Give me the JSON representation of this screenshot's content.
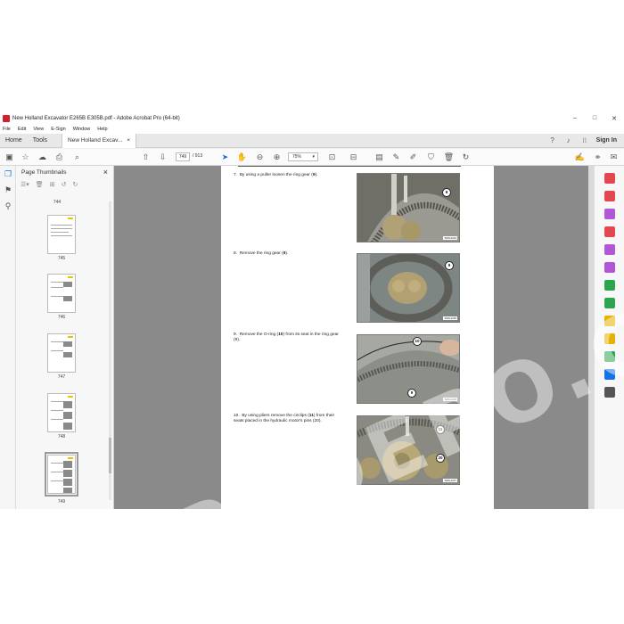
{
  "window": {
    "title": "New Holland Excavator E265B E305B.pdf - Adobe Acrobat Pro (64-bit)",
    "controls": [
      "–",
      "□",
      "✕"
    ]
  },
  "menu": [
    "File",
    "Edit",
    "View",
    "E-Sign",
    "Window",
    "Help"
  ],
  "tabs": {
    "home": "Home",
    "tools": "Tools",
    "document": "New Holland Excav...",
    "document_close": "×",
    "sign_in": "Sign In"
  },
  "toolbar": {
    "current_page": "749",
    "total_pages": "/ 913",
    "zoom": "75%",
    "zoom_caret": "▾"
  },
  "thumbnails": {
    "title": "Page Thumbnails",
    "close": "×",
    "pages": [
      "744",
      "745",
      "746",
      "747",
      "748",
      "749"
    ],
    "selected": "749"
  },
  "document": {
    "steps": [
      {
        "num": "7.",
        "text_before": "By using a puller loosen the ring gear (",
        "bold": "9",
        "text_after": ").",
        "callouts": [
          "9"
        ],
        "tag": "SMG1234"
      },
      {
        "num": "8.",
        "text_before": "Remove the ring gear (",
        "bold": "9",
        "text_after": ").",
        "callouts": [
          "9"
        ],
        "tag": "SMG1235"
      },
      {
        "num": "9.",
        "text_before": "Remove the O-ring (",
        "bold": "10",
        "text_after": ") from its seat in the ring gear (9).",
        "callouts": [
          "10",
          "9"
        ],
        "tag": "SMG1236"
      },
      {
        "num": "10.",
        "text_before": "By using pliers remove the circlips (",
        "bold": "11",
        "text_after": ") from their seats placed in the hydraulic motor's pins (20).",
        "callouts": [
          "11",
          "20"
        ],
        "tag": "SMG1237"
      }
    ]
  },
  "watermark": "EPCDEPO.COM",
  "colors": {
    "viewport_bg": "#8a8a8a",
    "acrobat_red": "#d2202f",
    "thumb_marker": "#e8c300"
  },
  "icons": {
    "left_strip": [
      "bookmark-icon",
      "attachment-icon",
      "paperclip-icon"
    ],
    "right_strip": [
      "export-pdf-icon",
      "create-pdf-icon",
      "edit-pdf-icon",
      "comment-icon",
      "organize-pages-icon",
      "fill-sign-icon",
      "redact-icon",
      "protect-icon",
      "scan-icon",
      "more-tools-icon"
    ]
  }
}
